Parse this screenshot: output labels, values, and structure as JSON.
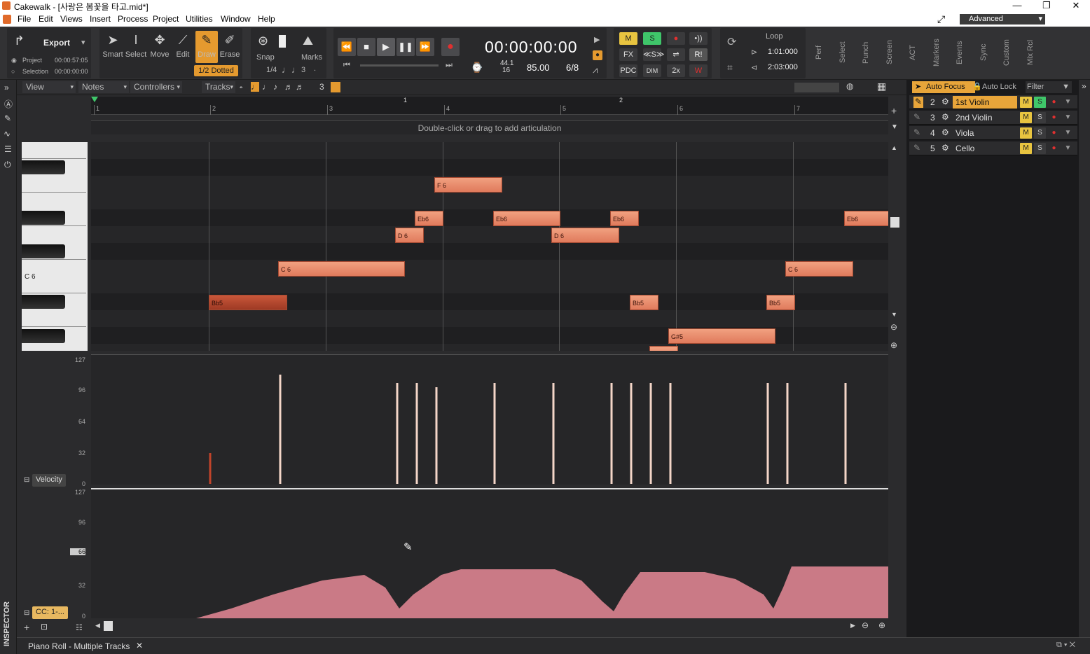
{
  "window": {
    "title": "Cakewalk - [사랑은 봄꽃을 타고.mid*]",
    "min": "—",
    "restore": "❐",
    "close": "✕"
  },
  "menu": [
    "File",
    "Edit",
    "Views",
    "Insert",
    "Process",
    "Project",
    "Utilities",
    "Window",
    "Help"
  ],
  "workspace": "Advanced",
  "export": {
    "label": "Export",
    "project_label": "Project",
    "project_time": "00:00:57:05",
    "selection_label": "Selection",
    "selection_time": "00:00:00:00"
  },
  "tools": {
    "smart": "Smart",
    "select": "Select",
    "move": "Move",
    "edit": "Edit",
    "draw": "Draw",
    "erase": "Erase",
    "duration": "1/2 Dotted"
  },
  "snap": {
    "label": "Snap",
    "marks": "Marks",
    "value": "1/4",
    "triplet": "3",
    "dot": "."
  },
  "transport": {
    "time": "00:00:00:00",
    "sample_rate": "44.1",
    "bit_depth": "16",
    "tempo": "85.00",
    "meter": "6/8"
  },
  "mix": {
    "m": "M",
    "s": "S",
    "fx": "FX",
    "pdc": "PDC",
    "dim": "DIM",
    "x2": "2x",
    "r": "R!"
  },
  "loop": {
    "label": "Loop",
    "start": "1:01:000",
    "end": "2:03:000"
  },
  "modules": [
    "Perf",
    "Select",
    "Punch",
    "Screen",
    "ACT",
    "Markers",
    "Events",
    "Sync",
    "Custom",
    "Mix Rcl"
  ],
  "pr_toolbar": {
    "view": "View",
    "notes": "Notes",
    "controllers": "Controllers",
    "tracks": "Tracks",
    "triplet": "3"
  },
  "ruler": {
    "markers": [
      "1",
      "2",
      "3",
      "4",
      "5",
      "6",
      "7"
    ],
    "section_markers": [
      "1",
      "2"
    ]
  },
  "articulation_hint": "Double-click or drag to add articulation",
  "keyboard_label": "C 6",
  "notes": [
    {
      "pitch": "F 6"
    },
    {
      "pitch": "Eb6"
    },
    {
      "pitch": "Eb6"
    },
    {
      "pitch": "Eb6"
    },
    {
      "pitch": "Eb6"
    },
    {
      "pitch": "D 6"
    },
    {
      "pitch": "D 6"
    },
    {
      "pitch": "C 6"
    },
    {
      "pitch": "C 6"
    },
    {
      "pitch": "Bb5"
    },
    {
      "pitch": "Bb5"
    },
    {
      "pitch": "Bb5"
    },
    {
      "pitch": "G#5"
    }
  ],
  "velocity": {
    "label": "Velocity",
    "axis": [
      "127",
      "96",
      "64",
      "32",
      "0"
    ]
  },
  "cc": {
    "label": "CC: 1-...",
    "axis": [
      "127",
      "96",
      "66",
      "32",
      "0"
    ]
  },
  "tracks_pane": {
    "auto_focus": "Auto Focus",
    "auto_lock": "Auto Lock",
    "filter": "Filter",
    "tracks": [
      {
        "num": "2",
        "name": "1st Violin"
      },
      {
        "num": "3",
        "name": "2nd Violin"
      },
      {
        "num": "4",
        "name": "Viola"
      },
      {
        "num": "5",
        "name": "Cello"
      }
    ],
    "m": "M",
    "s": "S"
  },
  "bottom": {
    "tab": "Piano Roll - Multiple Tracks",
    "close": "✕"
  },
  "inspector": "INSPECTOR",
  "colors": {
    "accent": "#e8a53a",
    "note": "#e88a6a",
    "note_selected": "#b14a30",
    "mute": "#e8c440",
    "solo": "#3fc66a",
    "record": "#e03030"
  }
}
